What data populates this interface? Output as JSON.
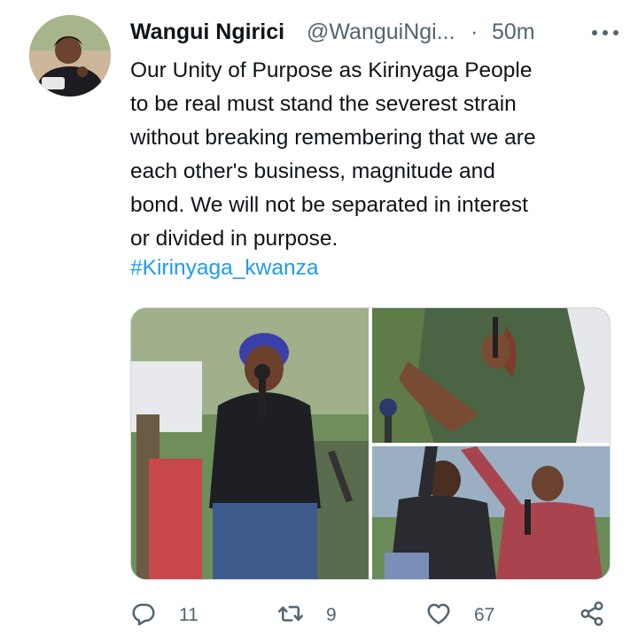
{
  "tweet": {
    "author_name": "Wangui Ngirici",
    "handle": "@WanguiNgi...",
    "separator": "·",
    "time": "50m",
    "text_lines": [
      "Our Unity of Purpose as Kirinyaga People",
      "to be real must stand the severest strain",
      "without breaking remembering that we are",
      "each other's business, magnitude and",
      "bond. We will not be separated in interest",
      "or divided in purpose."
    ],
    "hashtag": "#Kirinyaga_kwanza"
  },
  "actions": {
    "reply_count": "11",
    "retweet_count": "9",
    "like_count": "67"
  },
  "icons": {
    "more": "more-horizontal-icon",
    "reply": "reply-icon",
    "retweet": "retweet-icon",
    "like": "heart-icon",
    "share": "share-icon"
  },
  "colors": {
    "link": "#1d9bf0",
    "secondary_text": "#536471",
    "primary_text": "#0f1419"
  }
}
